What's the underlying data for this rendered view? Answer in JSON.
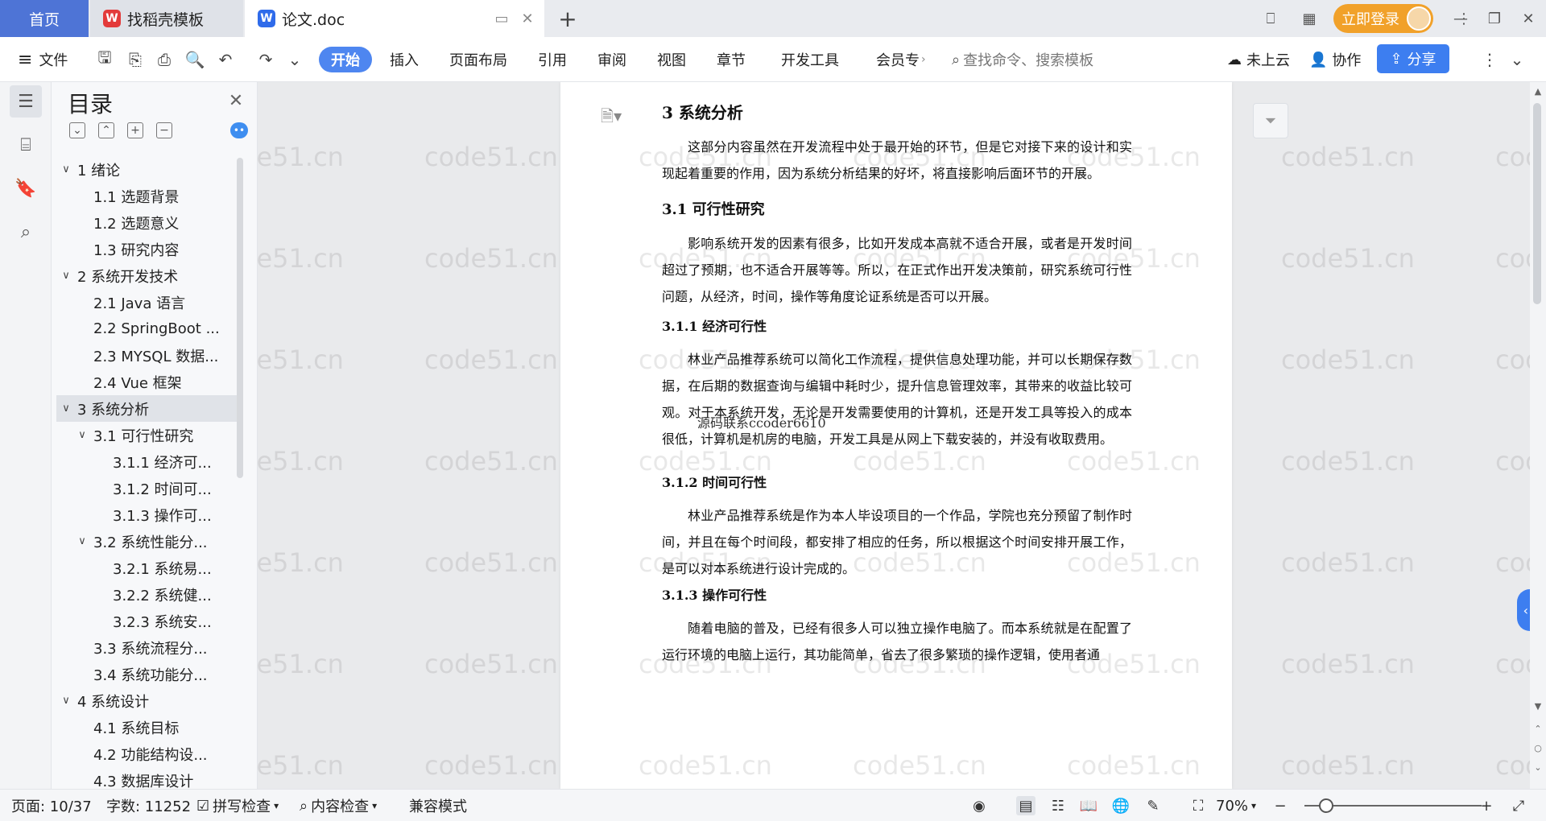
{
  "tabs": {
    "home": "首页",
    "docer": "找稻壳模板",
    "doc": "论文.doc",
    "login": "立即登录"
  },
  "toolbar": {
    "file": "文件",
    "menu": [
      "开始",
      "插入",
      "页面布局",
      "引用",
      "审阅",
      "视图",
      "章节",
      "开发工具",
      "会员专"
    ],
    "search_placeholder": "查找命令、搜索模板",
    "cloud": "未上云",
    "collab": "协作",
    "share": "分享"
  },
  "outline": {
    "title": "目录",
    "items": [
      {
        "label": "1  绪论",
        "level": 1,
        "caret": "∨"
      },
      {
        "label": "1.1  选题背景",
        "level": 2,
        "caret": ""
      },
      {
        "label": "1.2  选题意义",
        "level": 2,
        "caret": ""
      },
      {
        "label": "1.3  研究内容",
        "level": 2,
        "caret": ""
      },
      {
        "label": "2  系统开发技术",
        "level": 1,
        "caret": "∨"
      },
      {
        "label": "2.1 Java 语言",
        "level": 2,
        "caret": ""
      },
      {
        "label": "2.2 SpringBoot ...",
        "level": 2,
        "caret": ""
      },
      {
        "label": "2.3 MYSQL 数据...",
        "level": 2,
        "caret": ""
      },
      {
        "label": "2.4 Vue 框架",
        "level": 2,
        "caret": ""
      },
      {
        "label": "3  系统分析",
        "level": 1,
        "caret": "∨",
        "active": true
      },
      {
        "label": "3.1 可行性研究",
        "level": 2,
        "caret": "∨"
      },
      {
        "label": "3.1.1 经济可...",
        "level": 3,
        "caret": ""
      },
      {
        "label": "3.1.2 时间可...",
        "level": 3,
        "caret": ""
      },
      {
        "label": "3.1.3 操作可...",
        "level": 3,
        "caret": ""
      },
      {
        "label": "3.2 系统性能分...",
        "level": 2,
        "caret": "∨"
      },
      {
        "label": "3.2.1 系统易...",
        "level": 3,
        "caret": ""
      },
      {
        "label": "3.2.2 系统健...",
        "level": 3,
        "caret": ""
      },
      {
        "label": "3.2.3 系统安...",
        "level": 3,
        "caret": ""
      },
      {
        "label": "3.3  系统流程分...",
        "level": 2,
        "caret": ""
      },
      {
        "label": "3.4 系统功能分...",
        "level": 2,
        "caret": ""
      },
      {
        "label": "4  系统设计",
        "level": 1,
        "caret": "∨"
      },
      {
        "label": "4.1 系统目标",
        "level": 2,
        "caret": ""
      },
      {
        "label": "4.2 功能结构设...",
        "level": 2,
        "caret": ""
      },
      {
        "label": "4.3 数据库设计",
        "level": 2,
        "caret": ""
      }
    ]
  },
  "document": {
    "h_3": "3  系统分析",
    "p_intro": "这部分内容虽然在开发流程中处于最开始的环节，但是它对接下来的设计和实现起着重要的作用，因为系统分析结果的好坏，将直接影响后面环节的开展。",
    "h_3_1": "3.1 可行性研究",
    "p_3_1": "影响系统开发的因素有很多，比如开发成本高就不适合开展，或者是开发时间超过了预期，也不适合开展等等。所以，在正式作出开发决策前，研究系统可行性问题，从经济，时间，操作等角度论证系统是否可以开展。",
    "h_3_1_1": "3.1.1 经济可行性",
    "p_3_1_1": "林业产品推荐系统可以简化工作流程，提供信息处理功能，并可以长期保存数据，在后期的数据查询与编辑中耗时少，提升信息管理效率，其带来的收益比较可观。对于本系统开发，无论是开发需要使用的计算机，还是开发工具等投入的成本很低，计算机是机房的电脑，开发工具是从网上下载安装的，并没有收取费用。",
    "overlay": "源码联系ccoder6610",
    "h_3_1_2": "3.1.2 时间可行性",
    "p_3_1_2": "林业产品推荐系统是作为本人毕设项目的一个作品，学院也充分预留了制作时间，并且在每个时间段，都安排了相应的任务，所以根据这个时间安排开展工作，是可以对本系统进行设计完成的。",
    "h_3_1_3": "3.1.3 操作可行性",
    "p_3_1_3": "随着电脑的普及，已经有很多人可以独立操作电脑了。而本系统就是在配置了运行环境的电脑上运行，其功能简单，省去了很多繁琐的操作逻辑，使用者通"
  },
  "watermark": "code51.cn",
  "status": {
    "page": "页面: 10/37",
    "words": "字数: 11252",
    "spell": "拼写检查",
    "content_check": "内容检查",
    "compat": "兼容模式",
    "zoom": "70%",
    "zoom_level": 0.7
  },
  "colors": {
    "accent": "#4e86f0",
    "login": "#f1a12a",
    "home_tab": "#4e74d6"
  }
}
